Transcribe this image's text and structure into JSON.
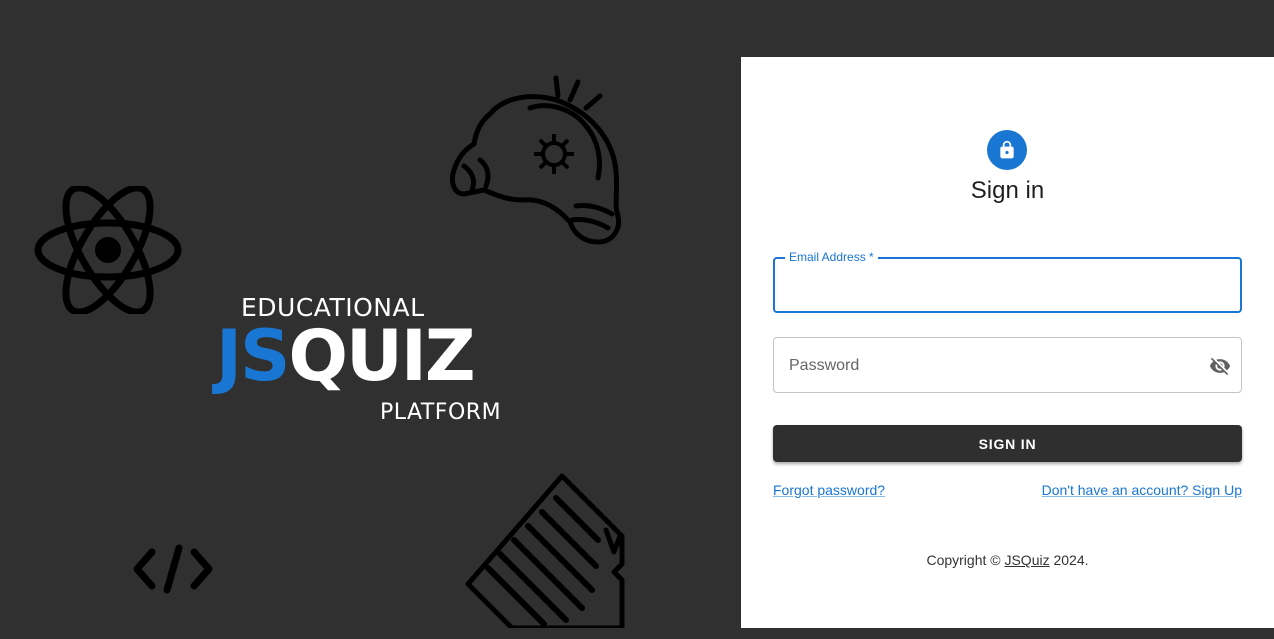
{
  "branding": {
    "logo_top": "EDUCATIONAL",
    "logo_js": "JS",
    "logo_quiz": "QUIZ",
    "logo_bottom": "PLATFORM",
    "decorations": [
      "react-atom-icon",
      "lightbulb-head-icon",
      "code-brackets-icon",
      "document-icon"
    ]
  },
  "signin": {
    "title": "Sign in",
    "avatar_icon": "lock-icon",
    "email": {
      "label": "Email Address *",
      "value": ""
    },
    "password": {
      "placeholder": "Password",
      "value": "",
      "toggle_icon": "visibility-off-icon"
    },
    "submit_label": "SIGN IN",
    "forgot_link": "Forgot password?",
    "signup_link": "Don't have an account? Sign Up",
    "copyright_prefix": "Copyright © ",
    "copyright_brand": "JSQuiz",
    "copyright_suffix": " 2024."
  },
  "colors": {
    "background": "#303030",
    "primary": "#1976d2",
    "button": "#2f2f2f",
    "panel": "#ffffff"
  }
}
